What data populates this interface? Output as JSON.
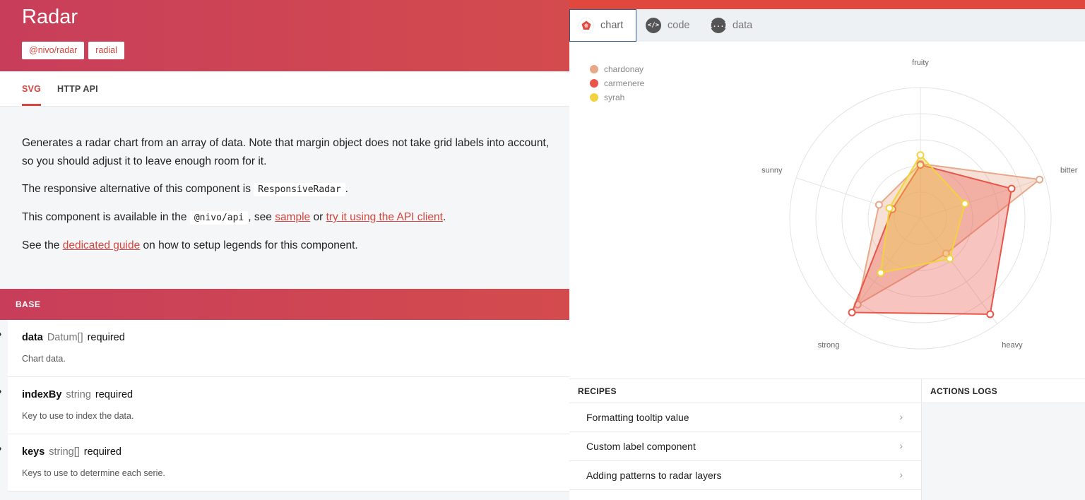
{
  "header": {
    "title": "Radar",
    "tags": [
      "@nivo/radar",
      "radial"
    ]
  },
  "tabs": [
    {
      "label": "SVG",
      "active": true
    },
    {
      "label": "HTTP API",
      "active": false
    }
  ],
  "description": {
    "p1": "Generates a radar chart from an array of data. Note that margin object does not take grid labels into account, so you should adjust it to leave enough room for it.",
    "p2_before": "The responsive alternative of this component is ",
    "p2_code": "ResponsiveRadar",
    "p2_after": ".",
    "p3_before": "This component is available in the ",
    "p3_code": "@nivo/api",
    "p3_mid1": ", see ",
    "p3_link1": "sample",
    "p3_mid2": " or ",
    "p3_link2": "try it using the API client",
    "p3_after": ".",
    "p4_before": "See the ",
    "p4_link": "dedicated guide",
    "p4_after": " on how to setup legends for this component."
  },
  "section": {
    "title": "BASE"
  },
  "props": [
    {
      "name": "data",
      "type": "Datum[]",
      "required": "required",
      "desc": "Chart data."
    },
    {
      "name": "indexBy",
      "type": "string",
      "required": "required",
      "desc": "Key to use to index the data."
    },
    {
      "name": "keys",
      "type": "string[]",
      "required": "required",
      "desc": "Keys to use to determine each serie."
    }
  ],
  "right_tabs": [
    {
      "label": "chart",
      "icon": "radar-chart-icon",
      "active": true
    },
    {
      "label": "code",
      "icon": "code-icon",
      "glyph": "</>",
      "active": false
    },
    {
      "label": "data",
      "icon": "data-icon",
      "glyph": "{...}",
      "active": false
    }
  ],
  "recipes": {
    "title": "RECIPES",
    "items": [
      "Formatting tooltip value",
      "Custom label component",
      "Adding patterns to radar layers"
    ]
  },
  "actions_logs": {
    "title": "ACTIONS LOGS"
  },
  "colors": {
    "accent": "#d4463f",
    "chardonay": "#e8a88a",
    "carmenere": "#e8564a",
    "syrah": "#f1d33f"
  },
  "chart_data": {
    "type": "radar",
    "axes": [
      "fruity",
      "bitter",
      "heavy",
      "strong",
      "sunny"
    ],
    "max": 120,
    "grid_levels": 5,
    "legend_placement": "top-left",
    "series": [
      {
        "name": "chardonay",
        "color": "#e8a88a",
        "values": [
          50,
          115,
          40,
          98,
          40
        ]
      },
      {
        "name": "carmenere",
        "color": "#e8564a",
        "values": [
          49,
          88,
          109,
          107,
          27
        ]
      },
      {
        "name": "syrah",
        "color": "#f1d33f",
        "values": [
          58,
          43,
          46,
          62,
          30
        ]
      }
    ]
  }
}
